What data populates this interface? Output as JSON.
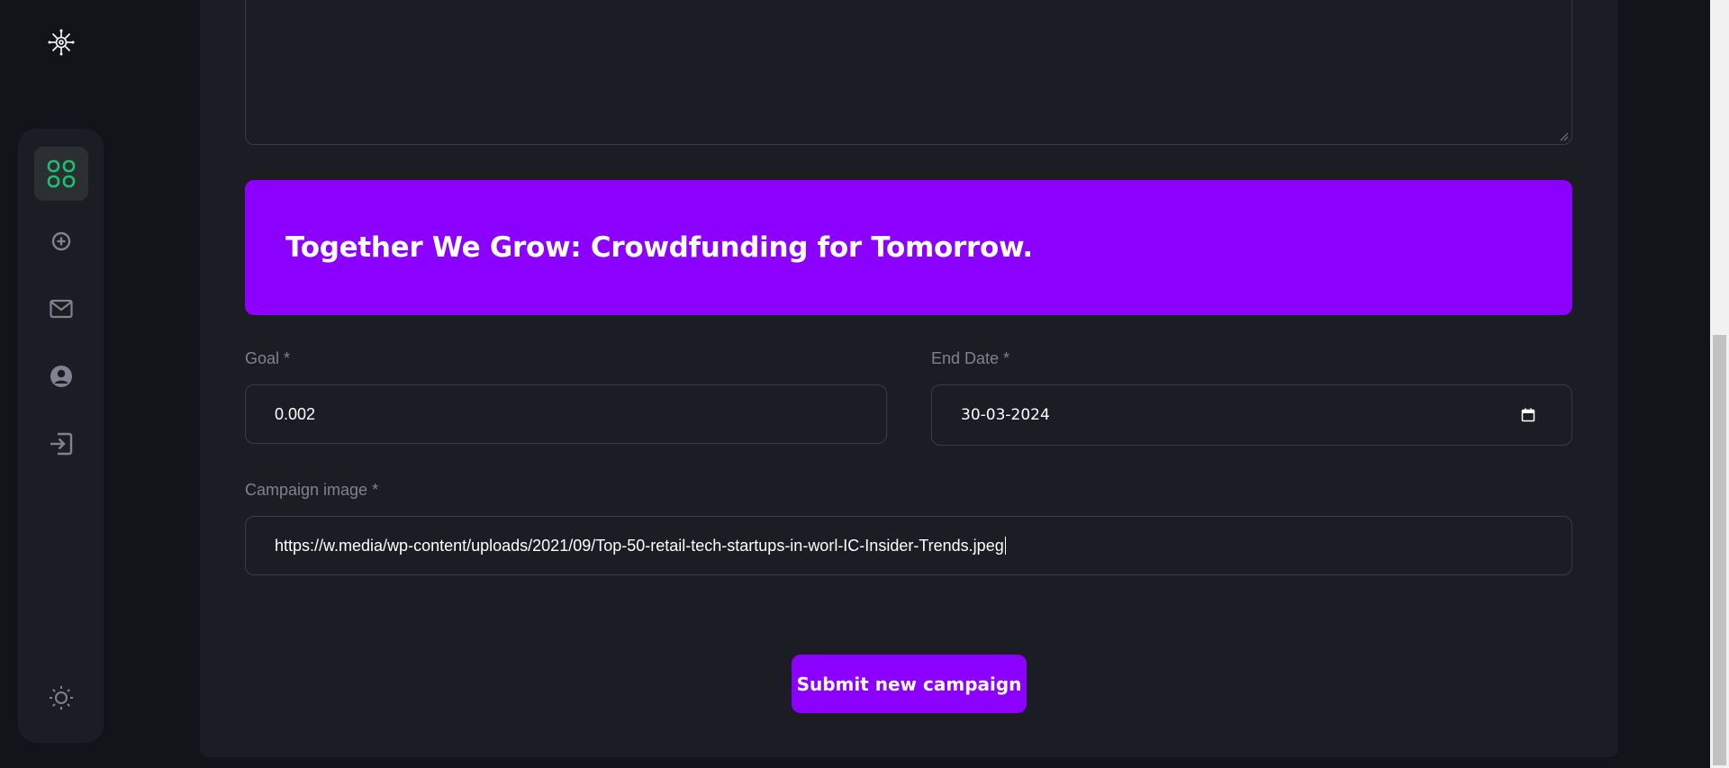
{
  "sidebar": {
    "items": [
      {
        "name": "dashboard",
        "icon": "grid-icon",
        "active": true
      },
      {
        "name": "create-campaign",
        "icon": "plus-circle-icon",
        "active": false
      },
      {
        "name": "messages",
        "icon": "mail-icon",
        "active": false
      },
      {
        "name": "profile",
        "icon": "user-icon",
        "active": false
      },
      {
        "name": "logout",
        "icon": "logout-icon",
        "active": false
      }
    ],
    "theme_icon": "sun-icon"
  },
  "banner": {
    "title": "Together We Grow: Crowdfunding for Tomorrow."
  },
  "form": {
    "goal_label": "Goal *",
    "goal_value": "0.002",
    "end_date_label": "End Date *",
    "end_date_value": "30-03-2024",
    "image_label": "Campaign image *",
    "image_value": "https://w.media/wp-content/uploads/2021/09/Top-50-retail-tech-startups-in-worl-IC-Insider-Trends.jpeg",
    "submit_label": "Submit new campaign"
  },
  "colors": {
    "accent": "#8c00ff",
    "active_icon": "#1dc071",
    "background": "#13131a",
    "card": "#1c1c24"
  }
}
